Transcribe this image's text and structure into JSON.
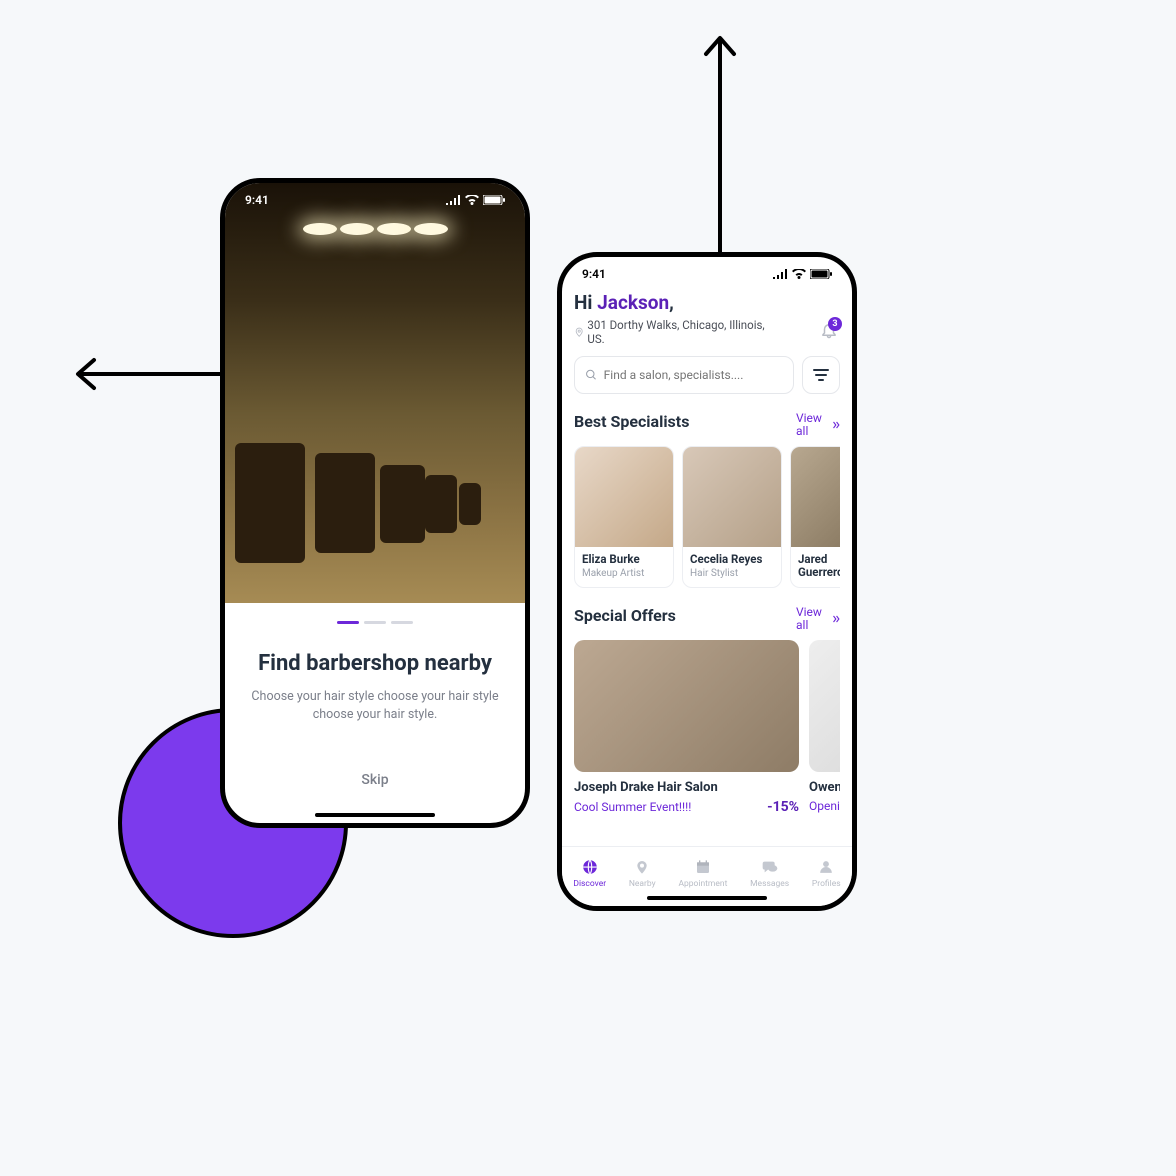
{
  "status": {
    "time": "9:41"
  },
  "onboard": {
    "title": "Find barbershop nearby",
    "subtitle": "Choose your hair style choose your hair style choose your hair style.",
    "skip": "Skip"
  },
  "home": {
    "hi": "Hi ",
    "username": "Jackson",
    "comma": ",",
    "address": "301 Dorthy Walks, Chicago, Illinois, US.",
    "notification_count": "3",
    "search_placeholder": "Find a salon, specialists....",
    "sections": {
      "specialists": {
        "title": "Best Specialists",
        "view_all": "View all"
      },
      "offers": {
        "title": "Special Offers",
        "view_all": "View all"
      }
    },
    "specialists": [
      {
        "name": "Eliza Burke",
        "role": "Makeup Artist"
      },
      {
        "name": "Cecelia Reyes",
        "role": "Hair Stylist"
      },
      {
        "name": "Jared Guerrero",
        "role": ""
      }
    ],
    "offers": [
      {
        "title": "Joseph Drake Hair Salon",
        "event": "Cool Summer Event!!!!",
        "discount": "-15%"
      },
      {
        "title": "Owen",
        "event": "Openi",
        "discount": ""
      }
    ],
    "tabs": [
      {
        "label": "Discover"
      },
      {
        "label": "Nearby"
      },
      {
        "label": "Appointment"
      },
      {
        "label": "Messages"
      },
      {
        "label": "Profiles"
      }
    ]
  }
}
